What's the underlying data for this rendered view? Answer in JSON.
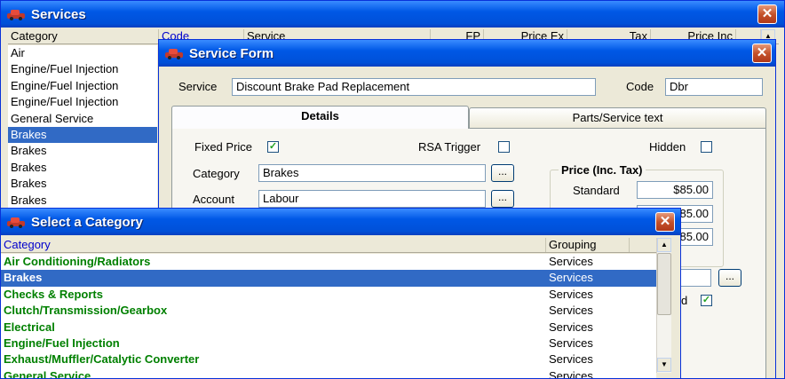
{
  "services_window": {
    "title": "Services",
    "close_label": "✕",
    "columns": [
      "Category",
      "Code",
      "Service",
      "FP",
      "Price Ex",
      "Tax",
      "Price Inc"
    ],
    "categories": [
      "Air",
      "Engine/Fuel Injection",
      "Engine/Fuel Injection",
      "Engine/Fuel Injection",
      "General Service",
      "Brakes",
      "Brakes",
      "Brakes",
      "Brakes",
      "Brakes"
    ],
    "selected_index": 5
  },
  "service_form": {
    "title": "Service Form",
    "close_label": "✕",
    "service_label": "Service",
    "service_value": "Discount Brake Pad Replacement",
    "code_label": "Code",
    "code_value": "Dbr",
    "tabs": [
      "Details",
      "Parts/Service text"
    ],
    "fixed_price_label": "Fixed Price",
    "fixed_price_checked": true,
    "rsa_trigger_label": "RSA Trigger",
    "rsa_trigger_checked": false,
    "hidden_label": "Hidden",
    "hidden_checked": false,
    "category_label": "Category",
    "category_value": "Brakes",
    "account_label": "Account",
    "account_value": "Labour",
    "browse_label": "...",
    "price_group_label": "Price (Inc. Tax)",
    "standard_label": "Standard",
    "standard_value": "$85.00",
    "price_value_2": "$85.00",
    "price_value_3": "$85.00",
    "partial_check_label": "d",
    "partial_checked": true
  },
  "select_category": {
    "title": "Select a Category",
    "close_label": "✕",
    "col_category": "Category",
    "col_grouping": "Grouping",
    "selected_index": 1,
    "rows": [
      {
        "category": "Air Conditioning/Radiators",
        "grouping": "Services"
      },
      {
        "category": "Brakes",
        "grouping": "Services"
      },
      {
        "category": "Checks & Reports",
        "grouping": "Services"
      },
      {
        "category": "Clutch/Transmission/Gearbox",
        "grouping": "Services"
      },
      {
        "category": "Electrical",
        "grouping": "Services"
      },
      {
        "category": "Engine/Fuel Injection",
        "grouping": "Services"
      },
      {
        "category": "Exhaust/Muffler/Catalytic Converter",
        "grouping": "Services"
      },
      {
        "category": "General Service",
        "grouping": "Services"
      }
    ]
  },
  "icons": {
    "car": "car-icon",
    "close": "close-icon",
    "check": "✓",
    "scroll_up": "▲",
    "scroll_down": "▼"
  },
  "colors": {
    "titlebar": "#0058e6",
    "selection": "#316ac5",
    "category_text": "#008000",
    "close_button": "#c4522b"
  }
}
